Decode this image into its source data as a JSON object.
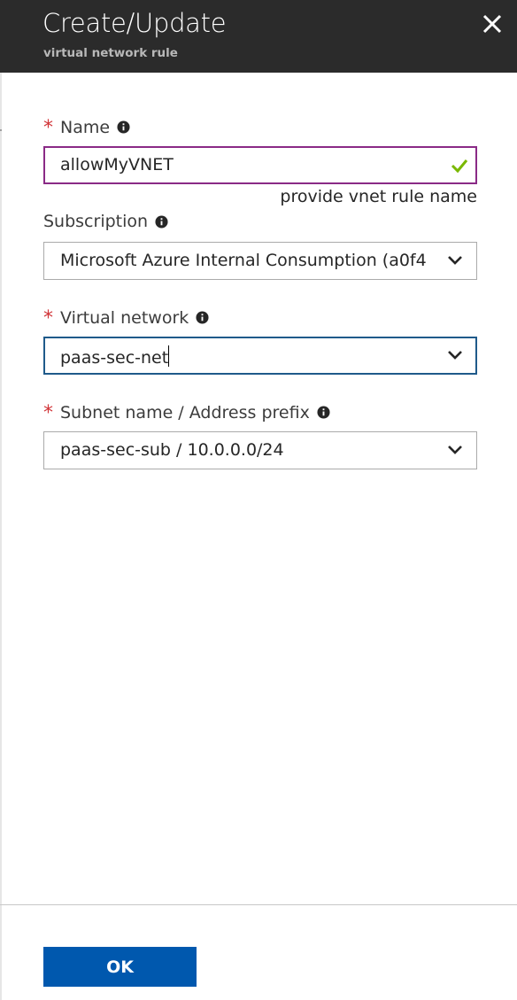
{
  "header": {
    "title": "Create/Update",
    "subtitle": "virtual network rule",
    "close_icon": "close-icon"
  },
  "form": {
    "name": {
      "label": "Name",
      "required": true,
      "value": "allowMyVNET",
      "validation_icon": "checkmark-icon",
      "hint": "provide vnet rule name"
    },
    "subscription": {
      "label": "Subscription",
      "required": false,
      "value": "Microsoft Azure Internal Consumption (a0f4"
    },
    "virtual_network": {
      "label": "Virtual network",
      "required": true,
      "value": "paas-sec-net"
    },
    "subnet": {
      "label": "Subnet name / Address prefix",
      "required": true,
      "value": "paas-sec-sub / 10.0.0.0/24"
    }
  },
  "footer": {
    "ok_label": "OK"
  },
  "colors": {
    "header_bg": "#2b2b2b",
    "required_star": "#d13438",
    "valid_border": "#8a2a86",
    "focus_border": "#1f5a8a",
    "check_green": "#7ab800",
    "primary_button": "#0058ae"
  }
}
